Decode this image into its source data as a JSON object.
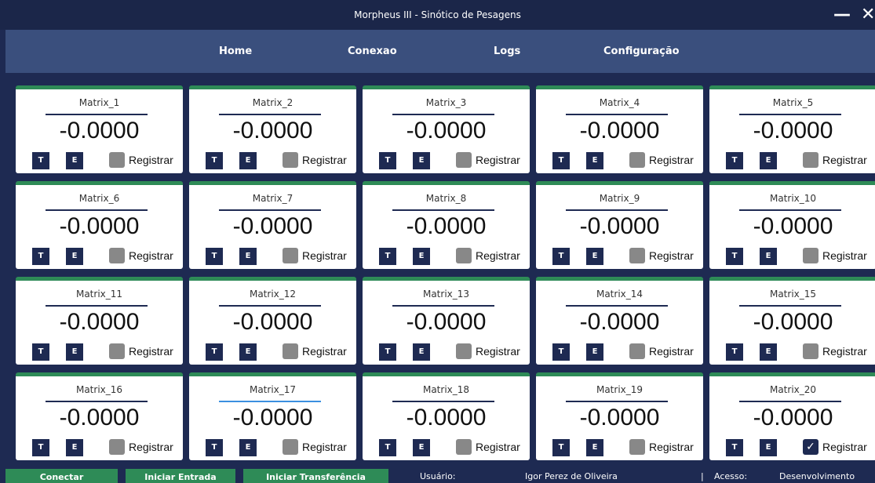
{
  "window": {
    "title": "Morpheus III - Sinótico de Pesagens",
    "minimize_glyph": "—",
    "close_glyph": "✕"
  },
  "nav": {
    "items": [
      {
        "label": "Home"
      },
      {
        "label": "Conexao"
      },
      {
        "label": "Logs"
      },
      {
        "label": "Configuração"
      }
    ]
  },
  "cards": [
    {
      "name": "Matrix_1",
      "value": "-0.0000",
      "t_label": "T",
      "e_label": "E",
      "register_label": "Registrar",
      "checked": false
    },
    {
      "name": "Matrix_2",
      "value": "-0.0000",
      "t_label": "T",
      "e_label": "E",
      "register_label": "Registrar",
      "checked": false
    },
    {
      "name": "Matrix_3",
      "value": "-0.0000",
      "t_label": "T",
      "e_label": "E",
      "register_label": "Registrar",
      "checked": false
    },
    {
      "name": "Matrix_4",
      "value": "-0.0000",
      "t_label": "T",
      "e_label": "E",
      "register_label": "Registrar",
      "checked": false
    },
    {
      "name": "Matrix_5",
      "value": "-0.0000",
      "t_label": "T",
      "e_label": "E",
      "register_label": "Registrar",
      "checked": false
    },
    {
      "name": "Matrix_6",
      "value": "-0.0000",
      "t_label": "T",
      "e_label": "E",
      "register_label": "Registrar",
      "checked": false
    },
    {
      "name": "Matrix_7",
      "value": "-0.0000",
      "t_label": "T",
      "e_label": "E",
      "register_label": "Registrar",
      "checked": false
    },
    {
      "name": "Matrix_8",
      "value": "-0.0000",
      "t_label": "T",
      "e_label": "E",
      "register_label": "Registrar",
      "checked": false
    },
    {
      "name": "Matrix_9",
      "value": "-0.0000",
      "t_label": "T",
      "e_label": "E",
      "register_label": "Registrar",
      "checked": false
    },
    {
      "name": "Matrix_10",
      "value": "-0.0000",
      "t_label": "T",
      "e_label": "E",
      "register_label": "Registrar",
      "checked": false
    },
    {
      "name": "Matrix_11",
      "value": "-0.0000",
      "t_label": "T",
      "e_label": "E",
      "register_label": "Registrar",
      "checked": false
    },
    {
      "name": "Matrix_12",
      "value": "-0.0000",
      "t_label": "T",
      "e_label": "E",
      "register_label": "Registrar",
      "checked": false
    },
    {
      "name": "Matrix_13",
      "value": "-0.0000",
      "t_label": "T",
      "e_label": "E",
      "register_label": "Registrar",
      "checked": false
    },
    {
      "name": "Matrix_14",
      "value": "-0.0000",
      "t_label": "T",
      "e_label": "E",
      "register_label": "Registrar",
      "checked": false
    },
    {
      "name": "Matrix_15",
      "value": "-0.0000",
      "t_label": "T",
      "e_label": "E",
      "register_label": "Registrar",
      "checked": false
    },
    {
      "name": "Matrix_16",
      "value": "-0.0000",
      "t_label": "T",
      "e_label": "E",
      "register_label": "Registrar",
      "checked": false
    },
    {
      "name": "Matrix_17",
      "value": "-0.0000",
      "t_label": "T",
      "e_label": "E",
      "register_label": "Registrar",
      "checked": false,
      "focused": true
    },
    {
      "name": "Matrix_18",
      "value": "-0.0000",
      "t_label": "T",
      "e_label": "E",
      "register_label": "Registrar",
      "checked": false
    },
    {
      "name": "Matrix_19",
      "value": "-0.0000",
      "t_label": "T",
      "e_label": "E",
      "register_label": "Registrar",
      "checked": false
    },
    {
      "name": "Matrix_20",
      "value": "-0.0000",
      "t_label": "T",
      "e_label": "E",
      "register_label": "Registrar",
      "checked": true
    }
  ],
  "bottom": {
    "connect_label": "Conectar",
    "start_entry_label": "Iniciar Entrada",
    "start_transfer_label": "Iniciar Transferência",
    "user_label": "Usuário:",
    "user_name": "Igor Perez de Oliveira",
    "separator": "|",
    "access_label": "Acesso:",
    "access_value": "Desenvolvimento"
  },
  "colors": {
    "background": "#1e2a52",
    "navbar": "#3a4f7d",
    "accent_green": "#2e8b57",
    "focus_blue": "#3b8fe0"
  }
}
